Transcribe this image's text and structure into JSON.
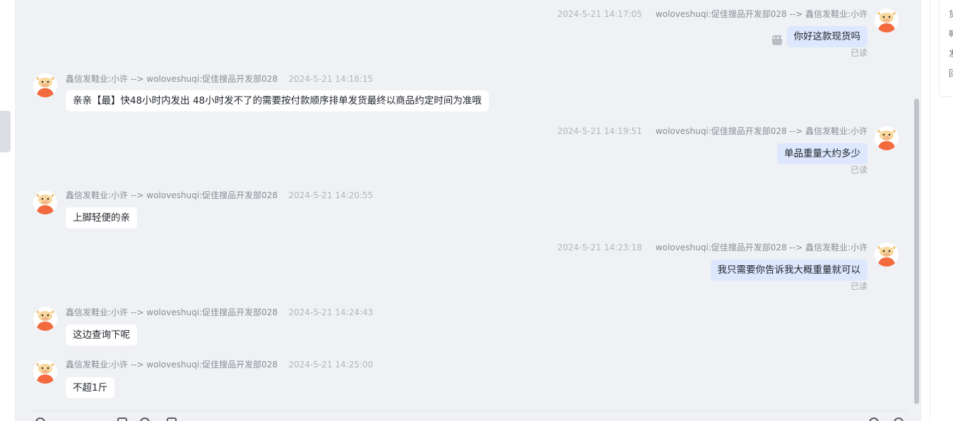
{
  "messages": [
    {
      "side": "right",
      "time": "2024-5-21 14:17:05",
      "names": "woloveshuqi:促佳搜品开发部028 --> 鑫信发鞋业:小许",
      "text": "你好这款现货吗",
      "read": "已读"
    },
    {
      "side": "left",
      "names": "鑫信发鞋业:小许 --> woloveshuqi:促佳搜品开发部028",
      "time": "2024-5-21 14:18:15",
      "text": "亲亲【最】快48小时内发出 48小时发不了的需要按付款顺序排单发货最终以商品约定时间为准哦"
    },
    {
      "side": "right",
      "time": "2024-5-21 14:19:51",
      "names": "woloveshuqi:促佳搜品开发部028 --> 鑫信发鞋业:小许",
      "text": "单品重量大约多少",
      "read": "已读"
    },
    {
      "side": "left",
      "names": "鑫信发鞋业:小许 --> woloveshuqi:促佳搜品开发部028",
      "time": "2024-5-21 14:20:55",
      "text": "上脚轻便的亲"
    },
    {
      "side": "right",
      "time": "2024-5-21 14:23:18",
      "names": "woloveshuqi:促佳搜品开发部028 --> 鑫信发鞋业:小许",
      "text": "我只需要你告诉我大概重量就可以",
      "read": "已读"
    },
    {
      "side": "left",
      "names": "鑫信发鞋业:小许 --> woloveshuqi:促佳搜品开发部028",
      "time": "2024-5-21 14:24:43",
      "text": "这边查询下呢"
    },
    {
      "side": "left",
      "names": "鑫信发鞋业:小许 --> woloveshuqi:促佳搜品开发部028",
      "time": "2024-5-21 14:25:00",
      "text": "不超1斤"
    }
  ],
  "right_panel": {
    "chars": [
      "货",
      "嘛",
      "发",
      "回"
    ]
  },
  "icons": {
    "avatar": "bull-avatar-icon",
    "more": "more-options-icon"
  }
}
